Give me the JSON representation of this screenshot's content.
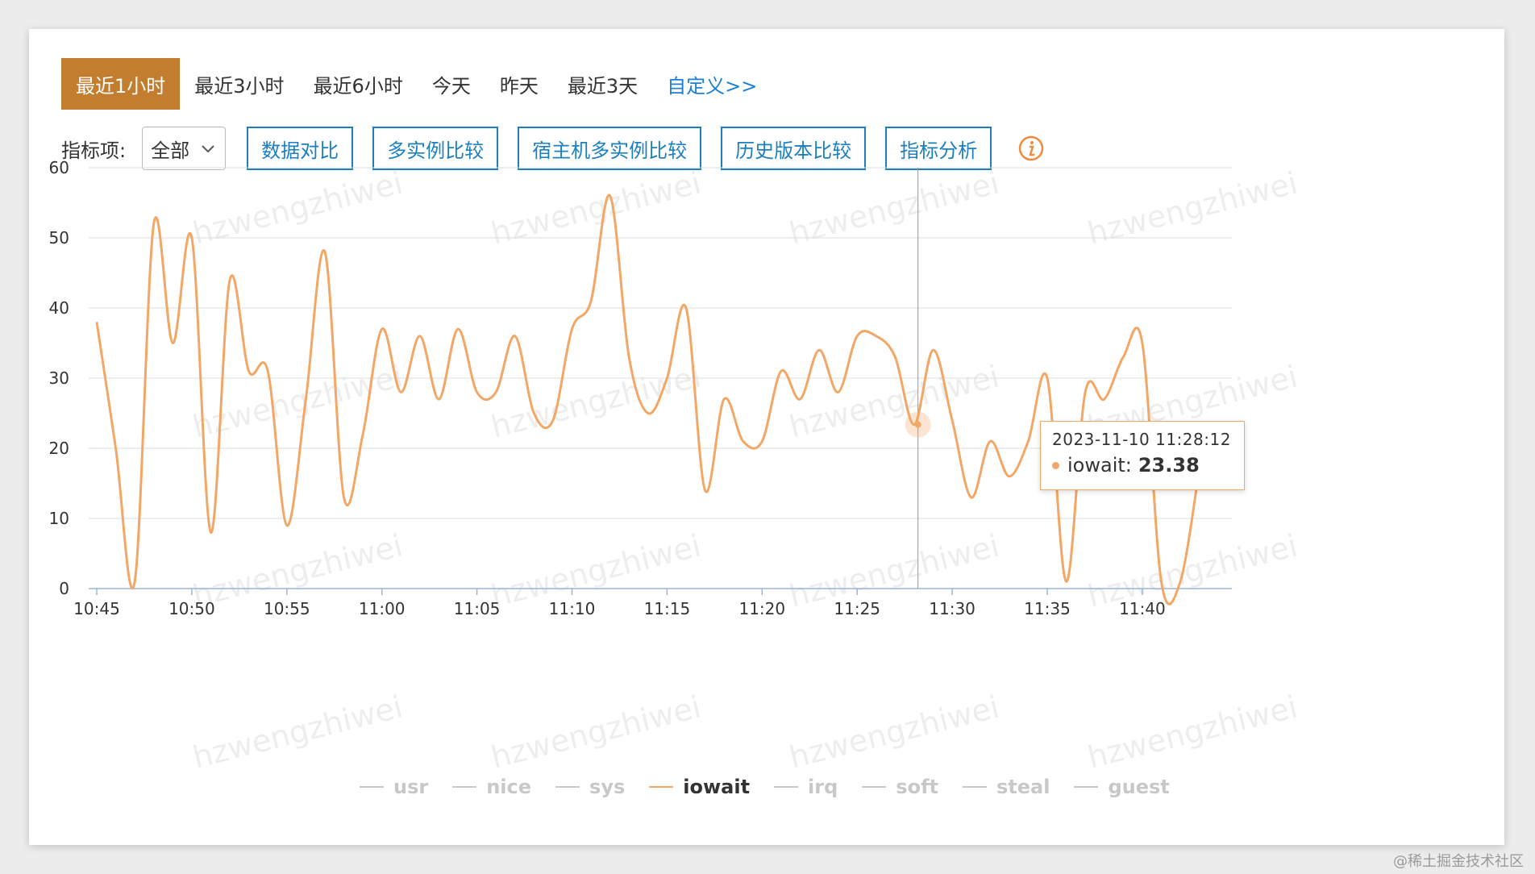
{
  "time_ranges": [
    "最近1小时",
    "最近3小时",
    "最近6小时",
    "今天",
    "昨天",
    "最近3天"
  ],
  "active_range": "最近1小时",
  "custom_link": "自定义>>",
  "toolbar": {
    "metric_label": "指标项:",
    "metric_value": "全部",
    "buttons": [
      "数据对比",
      "多实例比较",
      "宿主机多实例比较",
      "历史版本比较",
      "指标分析"
    ]
  },
  "tooltip": {
    "time": "2023-11-10 11:28:12",
    "series": "iowait:",
    "value": "23.38"
  },
  "watermark": "hzwengzhiwei",
  "footer": "@稀土掘金技术社区",
  "colors": {
    "accent": "#c27d2f",
    "line": "#f2a766",
    "button": "#1c7fbf",
    "link": "#1c80d8"
  },
  "chart_data": {
    "type": "line",
    "x_axis_type": "time",
    "ylim": [
      0,
      60
    ],
    "yticks": [
      "0",
      "10",
      "20",
      "30",
      "40",
      "50",
      "60"
    ],
    "xticks": [
      "10:45",
      "10:50",
      "10:55",
      "11:00",
      "11:05",
      "11:10",
      "11:15",
      "11:20",
      "11:25",
      "11:30",
      "11:35",
      "11:40"
    ],
    "xlim": [
      "10:45",
      "11:44"
    ],
    "grid": true,
    "legend": [
      "usr",
      "nice",
      "sys",
      "iowait",
      "irq",
      "soft",
      "steal",
      "guest"
    ],
    "legend_placement": "bottom",
    "active_series": "iowait",
    "series": [
      {
        "name": "iowait",
        "x": [
          "10:45",
          "10:46",
          "10:47",
          "10:48",
          "10:49",
          "10:50",
          "10:51",
          "10:52",
          "10:53",
          "10:54",
          "10:55",
          "10:56",
          "10:57",
          "10:58",
          "10:59",
          "11:00",
          "11:01",
          "11:02",
          "11:03",
          "11:04",
          "11:05",
          "11:06",
          "11:07",
          "11:08",
          "11:09",
          "11:10",
          "11:11",
          "11:12",
          "11:13",
          "11:14",
          "11:15",
          "11:16",
          "11:17",
          "11:18",
          "11:19",
          "11:20",
          "11:21",
          "11:22",
          "11:23",
          "11:24",
          "11:25",
          "11:26",
          "11:27",
          "11:28",
          "11:29",
          "11:30",
          "11:31",
          "11:32",
          "11:33",
          "11:34",
          "11:35",
          "11:36",
          "11:37",
          "11:38",
          "11:39",
          "11:40",
          "11:41",
          "11:42",
          "11:43"
        ],
        "y": [
          38,
          20,
          1,
          52,
          35,
          50,
          8,
          44,
          31,
          31,
          9,
          27,
          48,
          13,
          22,
          37,
          28,
          36,
          27,
          37,
          28,
          28,
          36,
          25,
          24,
          37,
          41,
          56,
          33,
          25,
          30,
          40,
          14,
          27,
          21,
          21,
          31,
          27,
          34,
          28,
          36,
          36,
          33,
          23.38,
          34,
          24,
          13,
          21,
          16,
          21,
          30,
          1,
          28,
          27,
          33,
          35,
          1,
          1,
          17
        ]
      }
    ]
  }
}
